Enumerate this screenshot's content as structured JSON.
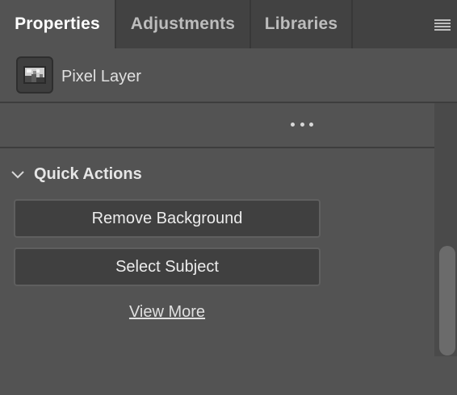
{
  "tabs": [
    {
      "label": "Properties",
      "active": true
    },
    {
      "label": "Adjustments",
      "active": false
    },
    {
      "label": "Libraries",
      "active": false
    }
  ],
  "panel_menu_icon": "hamburger-menu-icon",
  "layer": {
    "icon": "pixel-layer-icon",
    "label": "Pixel Layer"
  },
  "options": {
    "icon": "more-options-icon"
  },
  "quick_actions": {
    "title": "Quick Actions",
    "collapse_icon": "chevron-down-icon",
    "buttons": [
      {
        "label": "Remove Background"
      },
      {
        "label": "Select Subject"
      }
    ],
    "view_more": "View More"
  },
  "colors": {
    "panel_bg": "#535353",
    "tabbar_bg": "#424242",
    "button_bg": "#404040",
    "button_border": "#5f5f5f"
  }
}
